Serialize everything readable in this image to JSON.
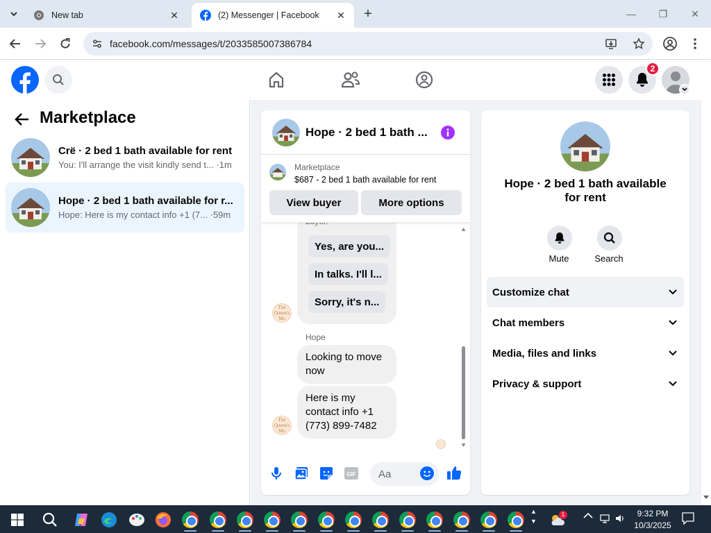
{
  "browser": {
    "tabs": [
      {
        "title": "New tab",
        "active": false
      },
      {
        "title": "(2) Messenger | Facebook",
        "active": true
      }
    ],
    "url": "facebook.com/messages/t/2033585007386784"
  },
  "fb": {
    "notification_count": "2",
    "colors": {
      "brand": "#0866ff",
      "badge": "#e41e3f",
      "accent_purple": "#a033ff"
    }
  },
  "left": {
    "title": "Marketplace",
    "conversations": [
      {
        "title": "Crë · 2 bed 1 bath available for rent",
        "snippet": "You: I'll arrange the visit kindly send t... ·1m",
        "active": false
      },
      {
        "title": "Hope · 2 bed 1 bath available for r...",
        "snippet": "Hope: Here is my contact info +1 (7... ·59m",
        "active": true
      }
    ]
  },
  "chat": {
    "title": "Hope · 2 bed 1 bath ...",
    "listing": {
      "source": "Marketplace",
      "description": "$687 - 2 bed 1 bath available for rent",
      "view_buyer": "View buyer",
      "more_options": "More options"
    },
    "partial_label": "buyer.",
    "quick_replies": [
      "Yes, are you...",
      "In talks. I'll l...",
      "Sorry, it's n..."
    ],
    "sender": "Hope",
    "messages": [
      "Looking to move now",
      "Here is my contact info +1 (773) 899-7482"
    ],
    "avatar_text": "The Queen's Mo",
    "composer_placeholder": "Aa"
  },
  "info": {
    "title": "Hope · 2 bed 1 bath available for rent",
    "actions": [
      {
        "label": "Mute",
        "icon": "bell-icon"
      },
      {
        "label": "Search",
        "icon": "search-icon"
      }
    ],
    "sections": [
      "Customize chat",
      "Chat members",
      "Media, files and links",
      "Privacy & support"
    ]
  },
  "taskbar": {
    "time": "9:32 PM",
    "date": "10/3/2025",
    "weather_badge": "1"
  }
}
